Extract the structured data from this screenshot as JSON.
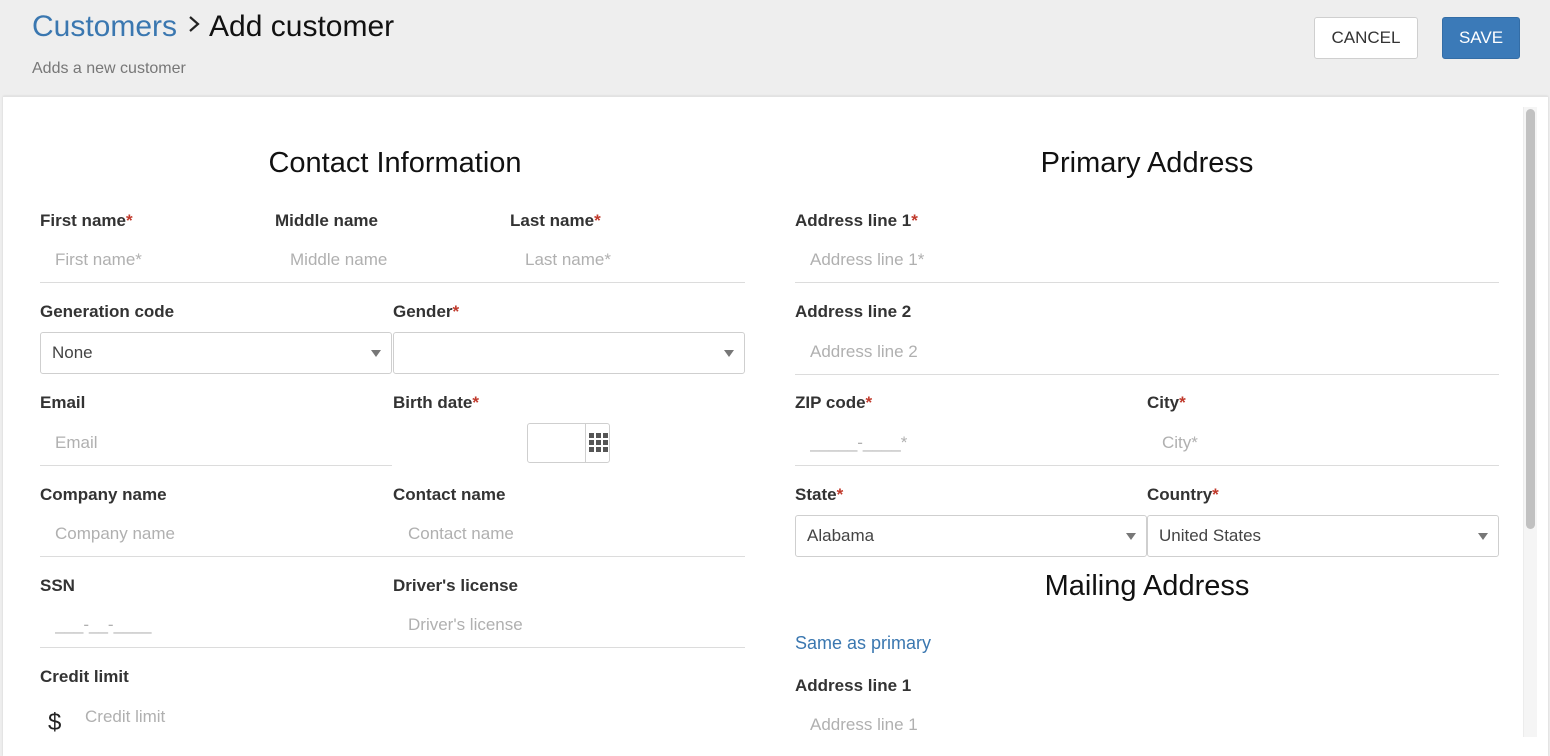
{
  "header": {
    "breadcrumb_root": "Customers",
    "breadcrumb_current": "Add customer",
    "subtitle": "Adds a new customer",
    "cancel_label": "CANCEL",
    "save_label": "SAVE"
  },
  "required_marker": "*",
  "contact": {
    "title": "Contact Information",
    "first_name": {
      "label": "First name",
      "placeholder": "First name*"
    },
    "middle_name": {
      "label": "Middle name",
      "placeholder": "Middle name"
    },
    "last_name": {
      "label": "Last name",
      "placeholder": "Last name*"
    },
    "generation_code": {
      "label": "Generation code",
      "value": "None"
    },
    "gender": {
      "label": "Gender",
      "value": ""
    },
    "email": {
      "label": "Email",
      "placeholder": "Email"
    },
    "birth_date": {
      "label": "Birth date"
    },
    "company_name": {
      "label": "Company name",
      "placeholder": "Company name"
    },
    "contact_name": {
      "label": "Contact name",
      "placeholder": "Contact name"
    },
    "ssn": {
      "label": "SSN",
      "placeholder": "___-__-____"
    },
    "drivers_license": {
      "label": "Driver's license",
      "placeholder": "Driver's license"
    },
    "credit_limit": {
      "label": "Credit limit",
      "placeholder": "Credit limit",
      "currency_symbol": "$"
    }
  },
  "primary_address": {
    "title": "Primary Address",
    "address_line_1": {
      "label": "Address line 1",
      "placeholder": "Address line 1*"
    },
    "address_line_2": {
      "label": "Address line 2",
      "placeholder": "Address line 2"
    },
    "zip_code": {
      "label": "ZIP code",
      "placeholder": "_____-____*"
    },
    "city": {
      "label": "City",
      "placeholder": "City*"
    },
    "state": {
      "label": "State",
      "value": "Alabama"
    },
    "country": {
      "label": "Country",
      "value": "United States"
    }
  },
  "mailing_address": {
    "title": "Mailing Address",
    "same_as_primary": "Same as primary",
    "address_line_1": {
      "label": "Address line 1",
      "placeholder": "Address line 1"
    }
  },
  "icons": {
    "breadcrumb_separator": "chevron-right-icon",
    "select_arrow": "caret-down-icon",
    "date_picker": "calendar-grid-icon",
    "currency": "dollar-icon"
  },
  "colors": {
    "link": "#3a77b0",
    "primary_button": "#3b7ab8",
    "required": "#c0392b",
    "background": "#eeeeee"
  }
}
